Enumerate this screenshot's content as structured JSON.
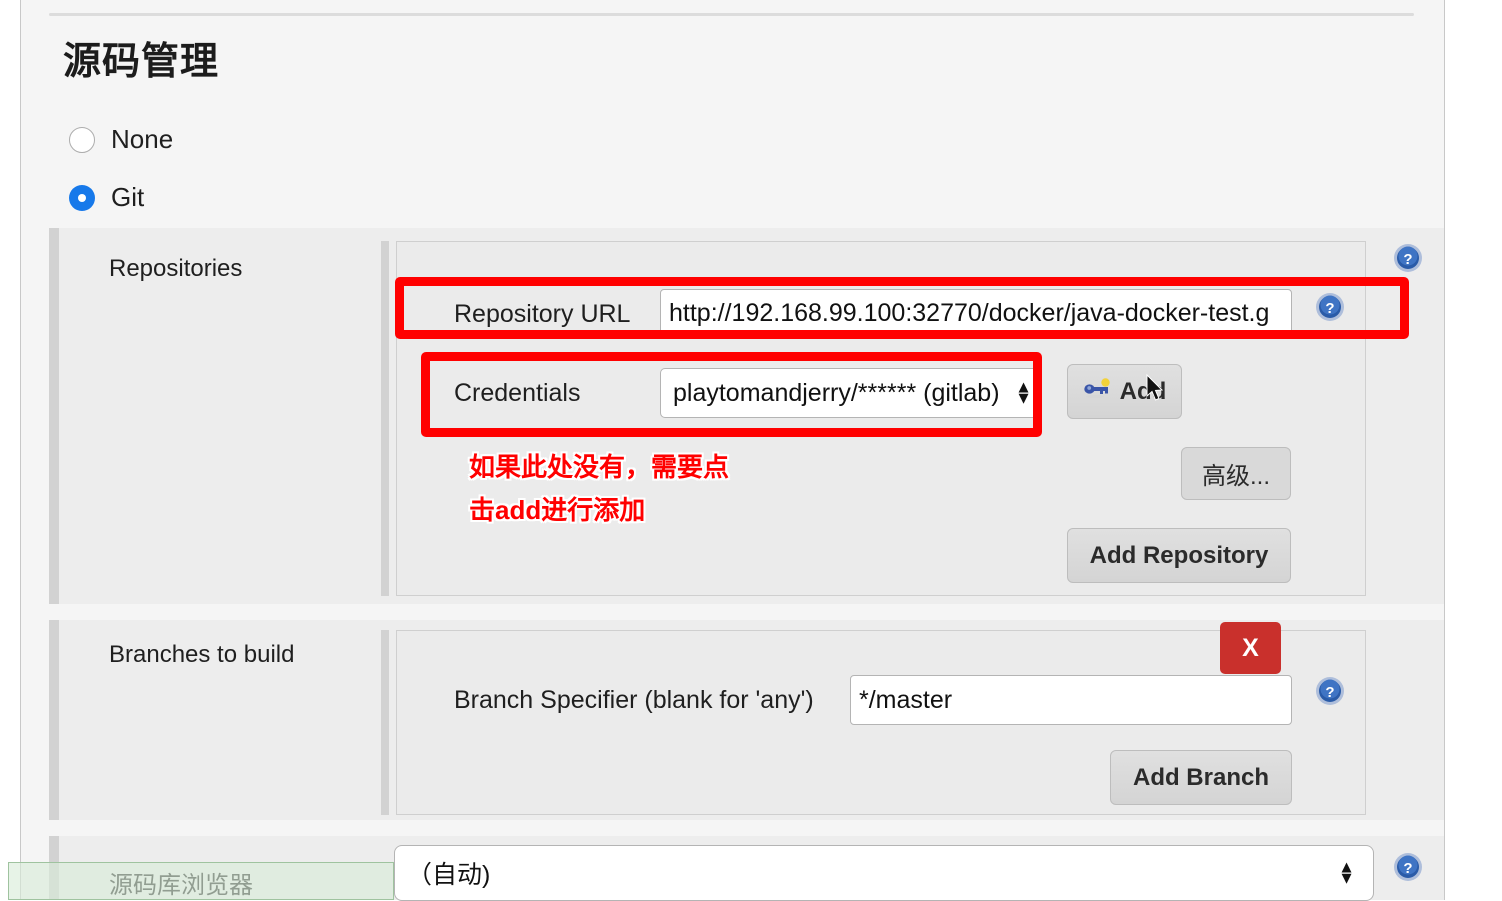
{
  "page": {
    "title": "源码管理"
  },
  "scm_radio": {
    "options": [
      {
        "label": "None",
        "selected": false
      },
      {
        "label": "Git",
        "selected": true
      }
    ]
  },
  "repositories": {
    "section_label": "Repositories",
    "repository_url": {
      "label": "Repository URL",
      "value": "http://192.168.99.100:32770/docker/java-docker-test.g"
    },
    "credentials": {
      "label": "Credentials",
      "value": "playtomandjerry/****** (gitlab)"
    },
    "add_credentials_button": "Add",
    "advanced_button": "高级...",
    "add_repository_button": "Add Repository"
  },
  "annotation": {
    "line1": "如果此处没有，需要点",
    "line2": "击add进行添加",
    "color": "#ff0000"
  },
  "branches": {
    "section_label": "Branches to build",
    "branch_specifier": {
      "label": "Branch Specifier (blank for 'any')",
      "value": "*/master"
    },
    "delete_button": "X",
    "add_branch_button": "Add Branch"
  },
  "repo_browser": {
    "label": "源码库浏览器",
    "value": "（自动)"
  },
  "icons": {
    "help": "help-icon",
    "key": "key-icon",
    "cursor": "mouse-cursor-icon",
    "spinner_up": "▲",
    "spinner_down": "▼"
  },
  "colors": {
    "accent_blue": "#1779ea",
    "annotation_red": "#ff0000",
    "delete_red": "#c9302c",
    "panel_bg": "#ebebeb",
    "page_bg": "#f5f5f5"
  }
}
